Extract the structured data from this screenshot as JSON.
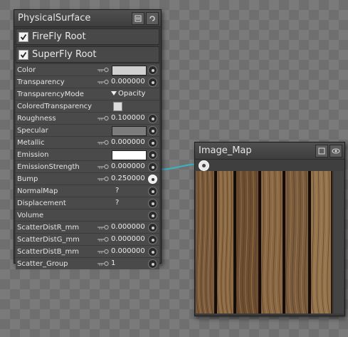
{
  "physical_surface": {
    "title": "PhysicalSurface",
    "roots": [
      {
        "label": "FireFly Root",
        "checked": true
      },
      {
        "label": "SuperFly Root",
        "checked": true
      }
    ],
    "properties": [
      {
        "label": "Color",
        "key": true,
        "value": "",
        "swatch": "#d0d0d0",
        "port": "empty"
      },
      {
        "label": "Transparency",
        "key": true,
        "value": "0.000000",
        "port": "empty"
      },
      {
        "label": "TransparencyMode",
        "key": false,
        "value": "Opacity",
        "dropdown": true,
        "port": "none"
      },
      {
        "label": "ColoredTransparency",
        "key": false,
        "value": "",
        "checkbox": true,
        "port": "none"
      },
      {
        "label": "Roughness",
        "key": true,
        "value": "0.100000",
        "port": "empty"
      },
      {
        "label": "Specular",
        "key": false,
        "value": "",
        "swatch": "#7c7c7c",
        "port": "empty"
      },
      {
        "label": "Metallic",
        "key": true,
        "value": "0.000000",
        "port": "empty"
      },
      {
        "label": "Emission",
        "key": false,
        "value": "",
        "swatch": "#ffffff",
        "port": "empty"
      },
      {
        "label": "EmissionStrength",
        "key": true,
        "value": "0.000000",
        "port": "empty"
      },
      {
        "label": "Bump",
        "key": true,
        "value": "0.250000",
        "port": "connected"
      },
      {
        "label": "NormalMap",
        "key": false,
        "value": "?",
        "port": "empty"
      },
      {
        "label": "Displacement",
        "key": false,
        "value": "?",
        "port": "empty"
      },
      {
        "label": "Volume",
        "key": false,
        "value": "",
        "port": "empty"
      },
      {
        "label": "ScatterDistR_mm",
        "key": true,
        "value": "0.000000",
        "port": "empty"
      },
      {
        "label": "ScatterDistG_mm",
        "key": true,
        "value": "0.000000",
        "port": "empty"
      },
      {
        "label": "ScatterDistB_mm",
        "key": true,
        "value": "0.000000",
        "port": "empty"
      },
      {
        "label": "Scatter_Group",
        "key": true,
        "value": "1",
        "port": "empty"
      }
    ]
  },
  "image_map": {
    "title": "Image_Map",
    "image": "wood-planks-texture"
  },
  "colors": {
    "connection_cable": "#38b3c6",
    "node_bg": "#3b3b3b",
    "row_bg": "#4a4a4a"
  },
  "icons": {
    "key": "key-icon",
    "port": "port-icon",
    "collapse": "collapse-icon",
    "preview": "preview-icon"
  }
}
